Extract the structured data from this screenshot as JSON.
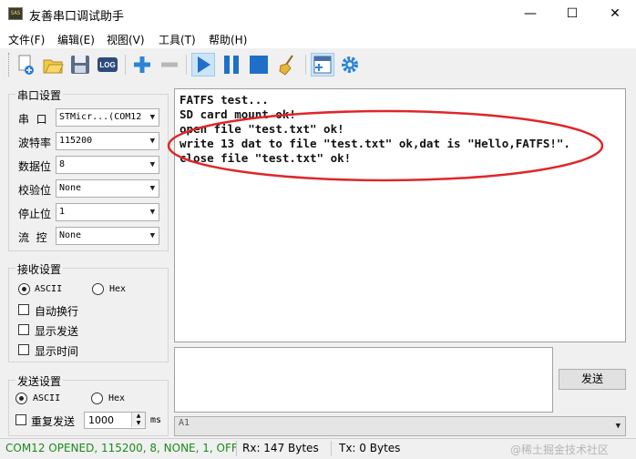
{
  "window": {
    "title": "友善串口调试助手",
    "icon_label": "SAS",
    "min_glyph": "—",
    "max_glyph": "☐",
    "close_glyph": "✕"
  },
  "menu": [
    "文件(F)",
    "编辑(E)",
    "视图(V)",
    "工具(T)",
    "帮助(H)"
  ],
  "toolbar": {
    "buttons": [
      "new-icon",
      "open-icon",
      "save-icon",
      "log-icon",
      "add-icon",
      "remove-icon",
      "play-icon",
      "pause-icon",
      "stop-icon",
      "clear-broom-icon",
      "layout-icon",
      "settings-gear-icon"
    ],
    "log_label": "LOG",
    "selected": [
      "play-icon",
      "layout-icon"
    ]
  },
  "serial_settings": {
    "title": "串口设置",
    "fields": [
      {
        "label": "串  口",
        "value": "STMicr...(COM12"
      },
      {
        "label": "波特率",
        "value": "115200"
      },
      {
        "label": "数据位",
        "value": "8"
      },
      {
        "label": "校验位",
        "value": "None"
      },
      {
        "label": "停止位",
        "value": "1"
      },
      {
        "label": "流  控",
        "value": "None"
      }
    ]
  },
  "receive_settings": {
    "title": "接收设置",
    "ascii_label": "ASCII",
    "hex_label": "Hex",
    "mode_selected": "ASCII",
    "options": [
      {
        "label": "自动换行",
        "checked": false
      },
      {
        "label": "显示发送",
        "checked": false
      },
      {
        "label": "显示时间",
        "checked": false
      }
    ]
  },
  "send_settings": {
    "title": "发送设置",
    "ascii_label": "ASCII",
    "hex_label": "Hex",
    "mode_selected": "ASCII",
    "repeat_label": "重复发送",
    "repeat_checked": false,
    "interval_value": "1000",
    "interval_unit": "ms"
  },
  "terminal": {
    "lines": [
      "FATFS test...",
      "SD card mount ok!",
      "open file \"test.txt\" ok!",
      "write 13 dat to file \"test.txt\" ok,dat is \"Hello,FATFS!\".",
      "close file \"test.txt\" ok!"
    ],
    "annotation_color": "#e0262a"
  },
  "send_area": {
    "input_value": "",
    "send_button": "发送",
    "history_value": "A1"
  },
  "status": {
    "port": "COM12 OPENED, 115200, 8, NONE, 1, OFF",
    "port_color": "#1a8a1a",
    "rx": "Rx: 147 Bytes",
    "tx": "Tx: 0 Bytes",
    "watermark": "@稀土掘金技术社区"
  }
}
